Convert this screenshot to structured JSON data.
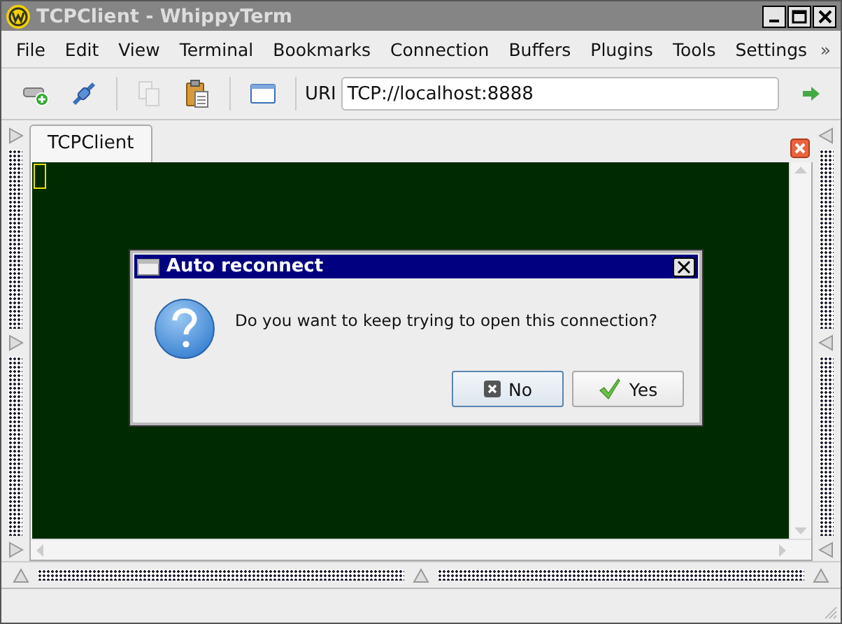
{
  "window": {
    "title": "TCPClient - WhippyTerm"
  },
  "menu": {
    "items": [
      {
        "label": "File"
      },
      {
        "label": "Edit"
      },
      {
        "label": "View"
      },
      {
        "label": "Terminal"
      },
      {
        "label": "Bookmarks"
      },
      {
        "label": "Connection"
      },
      {
        "label": "Buffers"
      },
      {
        "label": "Plugins"
      },
      {
        "label": "Tools"
      },
      {
        "label": "Settings"
      }
    ],
    "overflow": "»"
  },
  "toolbar": {
    "buttons": [
      {
        "kind": "new",
        "disabled": false
      },
      {
        "kind": "connect",
        "disabled": false
      },
      {
        "kind": "sep"
      },
      {
        "kind": "copy",
        "disabled": true
      },
      {
        "kind": "paste",
        "disabled": false
      },
      {
        "kind": "sep"
      },
      {
        "kind": "window",
        "disabled": false
      },
      {
        "kind": "sep"
      }
    ],
    "uri_label": "URI",
    "uri": "TCP://localhost:8888"
  },
  "tabs": [
    {
      "label": "TCPClient",
      "selected": true
    }
  ],
  "dialog": {
    "title": "Auto reconnect",
    "message": "Do you want to keep trying to open this connection?",
    "buttons": [
      {
        "label": "No",
        "kind": "no",
        "default": true
      },
      {
        "label": "Yes",
        "kind": "yes",
        "default": false
      }
    ]
  }
}
